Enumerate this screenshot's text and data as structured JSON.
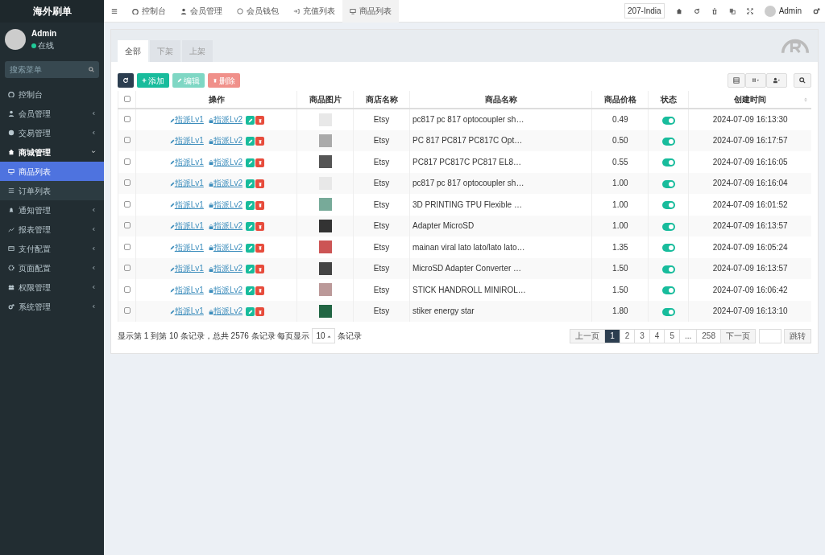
{
  "sidebar": {
    "brand": "海外刷单",
    "user": {
      "name": "Admin",
      "status": "在线"
    },
    "search": {
      "placeholder": "搜索菜单"
    },
    "items": [
      {
        "label": "控制台",
        "has_children": false,
        "expanded": false,
        "selected": false
      },
      {
        "label": "会员管理",
        "has_children": true,
        "expanded": false,
        "selected": false
      },
      {
        "label": "交易管理",
        "has_children": true,
        "expanded": false,
        "selected": false
      },
      {
        "label": "商城管理",
        "has_children": true,
        "expanded": true,
        "selected": false,
        "children": [
          {
            "label": "商品列表",
            "selected": true
          },
          {
            "label": "订单列表",
            "selected": false
          }
        ]
      },
      {
        "label": "通知管理",
        "has_children": true,
        "expanded": false,
        "selected": false
      },
      {
        "label": "报表管理",
        "has_children": true,
        "expanded": false,
        "selected": false
      },
      {
        "label": "支付配置",
        "has_children": true,
        "expanded": false,
        "selected": false
      },
      {
        "label": "页面配置",
        "has_children": true,
        "expanded": false,
        "selected": false
      },
      {
        "label": "权限管理",
        "has_children": true,
        "expanded": false,
        "selected": false
      },
      {
        "label": "系统管理",
        "has_children": true,
        "expanded": false,
        "selected": false
      }
    ]
  },
  "topbar": {
    "tabs": [
      {
        "label": "控制台",
        "selected": false
      },
      {
        "label": "会员管理",
        "selected": false
      },
      {
        "label": "会员钱包",
        "selected": false
      },
      {
        "label": "充值列表",
        "selected": false
      },
      {
        "label": "商品列表",
        "selected": true
      }
    ],
    "country": "207-India",
    "user": "Admin"
  },
  "subtabs": [
    {
      "label": "全部",
      "selected": true
    },
    {
      "label": "下架",
      "selected": false
    },
    {
      "label": "上架",
      "selected": false
    }
  ],
  "toolbar": {
    "add": "添加",
    "edit": "编辑",
    "delete": "删除"
  },
  "table": {
    "select_all_checked": false,
    "columns": [
      "操作",
      "商品图片",
      "商店名称",
      "商品名称",
      "商品价格",
      "状态",
      "创建时间"
    ],
    "rows": [
      {
        "checked": false,
        "lv1": "指派Lv1",
        "lv2": "指派Lv2",
        "store": "Etsy",
        "name": "pc817 pc 817 optocoupler sh…",
        "price": "0.49",
        "on": true,
        "time": "2024-07-09 16:13:30"
      },
      {
        "checked": false,
        "lv1": "指派Lv1",
        "lv2": "指派Lv2",
        "store": "Etsy",
        "name": "PC 817 PC817 PC817C Opt…",
        "price": "0.50",
        "on": true,
        "time": "2024-07-09 16:17:57"
      },
      {
        "checked": false,
        "lv1": "指派Lv1",
        "lv2": "指派Lv2",
        "store": "Etsy",
        "name": "PC817 PC817C PC817 EL8…",
        "price": "0.55",
        "on": true,
        "time": "2024-07-09 16:16:05"
      },
      {
        "checked": false,
        "lv1": "指派Lv1",
        "lv2": "指派Lv2",
        "store": "Etsy",
        "name": "pc817 pc 817 optocoupler sh…",
        "price": "1.00",
        "on": true,
        "time": "2024-07-09 16:16:04"
      },
      {
        "checked": false,
        "lv1": "指派Lv1",
        "lv2": "指派Lv2",
        "store": "Etsy",
        "name": "3D PRINTING TPU Flexible …",
        "price": "1.00",
        "on": true,
        "time": "2024-07-09 16:01:52"
      },
      {
        "checked": false,
        "lv1": "指派Lv1",
        "lv2": "指派Lv2",
        "store": "Etsy",
        "name": "Adapter MicroSD",
        "price": "1.00",
        "on": true,
        "time": "2024-07-09 16:13:57"
      },
      {
        "checked": false,
        "lv1": "指派Lv1",
        "lv2": "指派Lv2",
        "store": "Etsy",
        "name": "mainan viral lato lato/lato lato…",
        "price": "1.35",
        "on": true,
        "time": "2024-07-09 16:05:24"
      },
      {
        "checked": false,
        "lv1": "指派Lv1",
        "lv2": "指派Lv2",
        "store": "Etsy",
        "name": "MicroSD Adapter Converter …",
        "price": "1.50",
        "on": true,
        "time": "2024-07-09 16:13:57"
      },
      {
        "checked": false,
        "lv1": "指派Lv1",
        "lv2": "指派Lv2",
        "store": "Etsy",
        "name": "STICK HANDROLL MINIROL…",
        "price": "1.50",
        "on": true,
        "time": "2024-07-09 16:06:42"
      },
      {
        "checked": false,
        "lv1": "指派Lv1",
        "lv2": "指派Lv2",
        "store": "Etsy",
        "name": "stiker energy star",
        "price": "1.80",
        "on": true,
        "time": "2024-07-09 16:13:10"
      }
    ]
  },
  "footer": {
    "summary_before": "显示第 1 到第 10 条记录，总共 2576 条记录 每页显示",
    "page_size": "10",
    "summary_after": "条记录",
    "pages": [
      {
        "label": "上一页",
        "kind": "nav",
        "selected": false
      },
      {
        "label": "1",
        "kind": "page",
        "selected": true
      },
      {
        "label": "2",
        "kind": "page",
        "selected": false
      },
      {
        "label": "3",
        "kind": "page",
        "selected": false
      },
      {
        "label": "4",
        "kind": "page",
        "selected": false
      },
      {
        "label": "5",
        "kind": "page",
        "selected": false
      },
      {
        "label": "...",
        "kind": "page",
        "selected": false
      },
      {
        "label": "258",
        "kind": "page",
        "selected": false
      },
      {
        "label": "下一页",
        "kind": "nav",
        "selected": false
      }
    ],
    "jump": "跳转"
  }
}
